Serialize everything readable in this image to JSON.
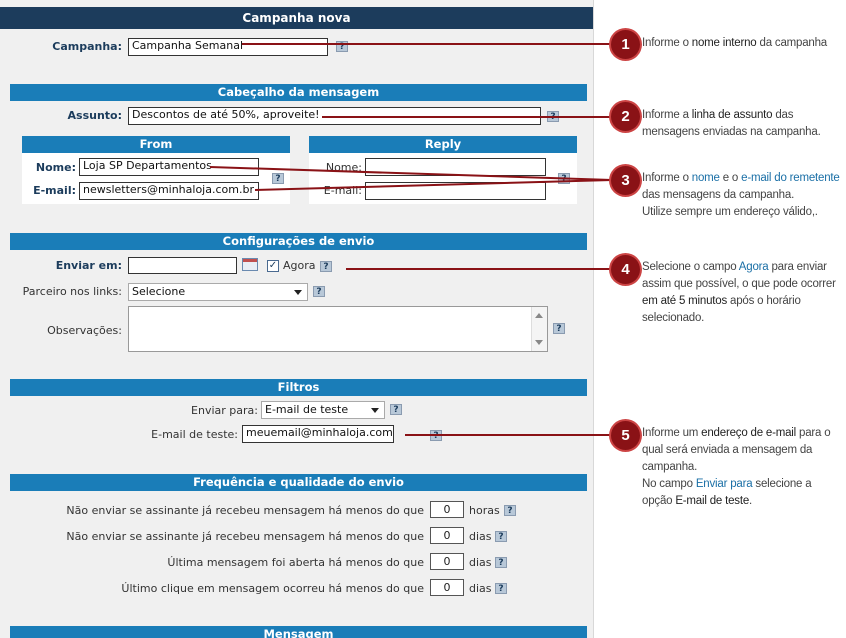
{
  "header": {
    "title": "Campanha nova"
  },
  "campanha": {
    "label": "Campanha:",
    "value": "Campanha Semanal"
  },
  "cabecalho": {
    "title": "Cabeçalho da mensagem",
    "assunto_label": "Assunto:",
    "assunto_value": "Descontos de até 50%, aproveite!",
    "from": {
      "title": "From",
      "nome_label": "Nome:",
      "nome_value": "Loja SP Departamentos",
      "email_label": "E-mail:",
      "email_value": "newsletters@minhaloja.com.br"
    },
    "reply": {
      "title": "Reply",
      "nome_label": "Nome:",
      "nome_value": "",
      "email_label": "E-mail:",
      "email_value": ""
    }
  },
  "config": {
    "title": "Configurações de envio",
    "enviar_em_label": "Enviar em:",
    "enviar_em_value": "",
    "agora_label": "Agora",
    "agora_checked": "✓",
    "parceiro_label": "Parceiro nos links:",
    "parceiro_value": "Selecione",
    "obs_label": "Observações:"
  },
  "filtros": {
    "title": "Filtros",
    "enviar_para_label": "Enviar para:",
    "enviar_para_value": "E-mail de teste",
    "email_teste_label": "E-mail de teste:",
    "email_teste_value": "meuemail@minhaloja.com.br"
  },
  "frequencia": {
    "title": "Frequência e qualidade do envio",
    "rows": [
      {
        "text": "Não enviar se assinante já recebeu mensagem há menos do que",
        "value": "0",
        "unit": "horas"
      },
      {
        "text": "Não enviar se assinante já recebeu mensagem há menos do que",
        "value": "0",
        "unit": "dias"
      },
      {
        "text": "Última mensagem foi aberta há menos do que",
        "value": "0",
        "unit": "dias"
      },
      {
        "text": "Último clique em mensagem ocorreu há menos do que",
        "value": "0",
        "unit": "dias"
      }
    ]
  },
  "mensagem": {
    "title": "Mensagem"
  },
  "help_glyph": "?",
  "annotations": [
    {
      "number": "1",
      "parts": [
        "Informe o ",
        "nome interno",
        " da campanha"
      ]
    },
    {
      "number": "2",
      "parts": [
        "Informe a ",
        "linha de assunto",
        " das mensagens enviadas na campanha."
      ]
    },
    {
      "number": "3",
      "parts": [
        "Informe o ",
        "nome",
        " e o ",
        "e-mail do remetente",
        " das mensagens da campanha.",
        "Utilize sempre um endereço válido,."
      ]
    },
    {
      "number": "4",
      "parts": [
        "Selecione o campo ",
        "Agora",
        " para enviar assim que possível, o que pode ocorrer ",
        "em até 5 minutos",
        " após o horário selecionado."
      ]
    },
    {
      "number": "5",
      "parts": [
        "Informe um ",
        "endereço de e-mail",
        " para o qual será enviada a mensagem da campanha.",
        "No campo ",
        "Enviar para",
        " selecione a opção ",
        "E-mail de teste",
        "."
      ]
    }
  ],
  "colors": {
    "header": "#1c3c5c",
    "section_bar": "#1a7db8",
    "marker": "#8a1216",
    "link": "#1a6fa6"
  }
}
